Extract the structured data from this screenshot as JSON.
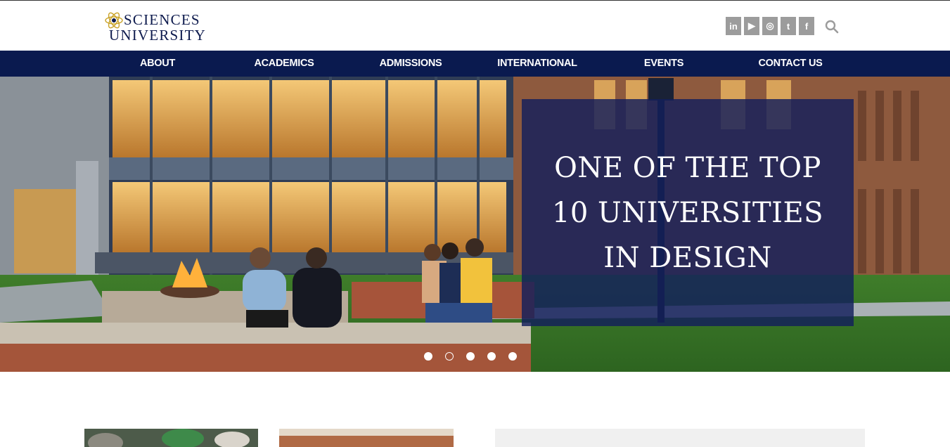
{
  "header": {
    "logo_line1": "SCIENCES",
    "logo_line2": "UNIVERSITY",
    "social": [
      {
        "label": "in",
        "icon": "linkedin-icon"
      },
      {
        "label": "▶",
        "icon": "youtube-icon"
      },
      {
        "label": "◎",
        "icon": "instagram-icon"
      },
      {
        "label": "t",
        "icon": "twitter-icon"
      },
      {
        "label": "f",
        "icon": "facebook-icon"
      }
    ],
    "search_icon": "search-icon"
  },
  "nav": {
    "items": [
      "ABOUT",
      "ACADEMICS",
      "ADMISSIONS",
      "INTERNATIONAL",
      "EVENTS",
      "CONTACT US"
    ]
  },
  "hero": {
    "caption": "ONE OF THE TOP 10 UNIVERSITIES IN DESIGN",
    "slide_count": 5,
    "active_slide": 2
  },
  "colors": {
    "nav_bg": "#0a1a4f",
    "caption_bg": "#121e5c",
    "logo_text": "#0d1a4d",
    "social_bg": "#9c9c9c"
  }
}
